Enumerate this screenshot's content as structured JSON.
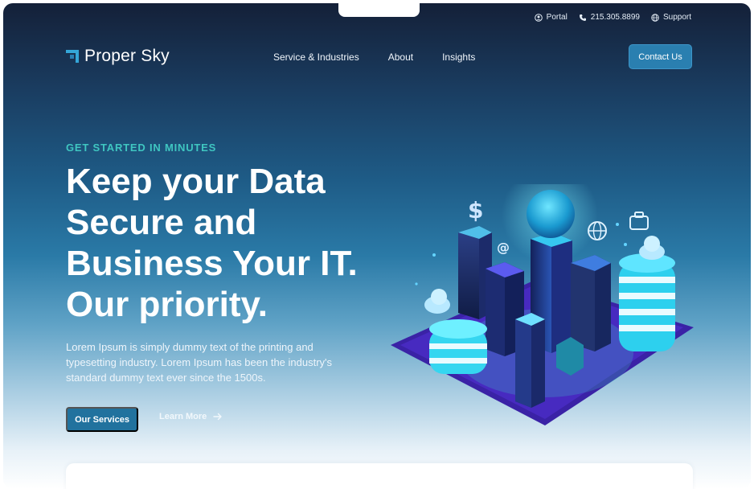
{
  "topbar": {
    "portal": "Portal",
    "phone": "215.305.8899",
    "support": "Support"
  },
  "brand": {
    "name": "Proper Sky"
  },
  "nav": {
    "items": [
      "Service & Industries",
      "About",
      "Insights"
    ],
    "cta": "Contact Us"
  },
  "hero": {
    "eyebrow": "GET STARTED IN MINUTES",
    "headline": [
      "Keep your Data",
      "Secure and",
      "Business Your IT.",
      "Our priority."
    ],
    "lead": "Lorem Ipsum is simply dummy text of the printing and typesetting industry. Lorem Ipsum has been the industry's standard dummy text ever since the 1500s.",
    "primary_button": "Our Services",
    "secondary_button": "Learn More",
    "illustration_symbols": [
      "$",
      "@"
    ]
  },
  "icons": [
    "user-icon",
    "phone-icon",
    "globe-icon",
    "arrow-right-icon"
  ],
  "colors": {
    "accent": "#3fc6c1",
    "button": "#21729e",
    "contact_button": "#2a7fb0",
    "bg_top": "#142038",
    "bg_mid": "#1e5b86"
  }
}
